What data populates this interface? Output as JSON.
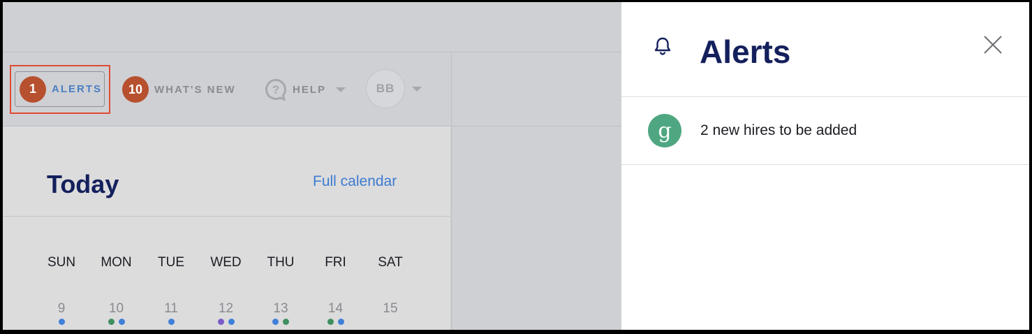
{
  "nav": {
    "alerts": {
      "count": "1",
      "label": "ALERTS"
    },
    "whats_new": {
      "count": "10",
      "label": "WHAT'S NEW"
    },
    "help": {
      "label": "HELP",
      "icon": "help-bubble-icon"
    },
    "user": {
      "initials": "BB"
    }
  },
  "today": {
    "title": "Today",
    "full_calendar_link": "Full calendar",
    "weekdays": [
      "SUN",
      "MON",
      "TUE",
      "WED",
      "THU",
      "FRI",
      "SAT"
    ],
    "days": [
      {
        "num": "9",
        "dots": [
          "#3f80d8"
        ]
      },
      {
        "num": "10",
        "dots": [
          "#3f8f5f",
          "#3f80d8"
        ]
      },
      {
        "num": "11",
        "dots": [
          "#3f80d8"
        ]
      },
      {
        "num": "12",
        "dots": [
          "#7a5cc8",
          "#3f80d8"
        ]
      },
      {
        "num": "13",
        "dots": [
          "#3f80d8",
          "#3f8f5f"
        ]
      },
      {
        "num": "14",
        "dots": [
          "#3f8f5f",
          "#3f80d8"
        ]
      },
      {
        "num": "15",
        "dots": []
      }
    ]
  },
  "alerts_panel": {
    "title": "Alerts",
    "icon": "bell-icon",
    "close_icon": "close-icon",
    "items": [
      {
        "icon_letter": "g",
        "text": "2 new hires to be added",
        "icon_color": "#4fa781"
      }
    ]
  },
  "colors": {
    "badge": "#b7502e",
    "highlight": "#e04b34",
    "title_navy": "#14205c",
    "link_blue": "#3d7bd1"
  }
}
